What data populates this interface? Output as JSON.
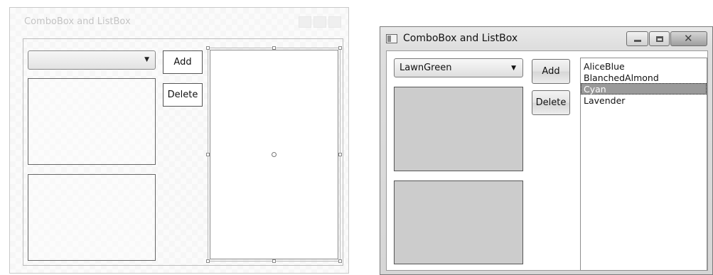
{
  "designer": {
    "title": "ComboBox and ListBox",
    "combo": {
      "value": ""
    },
    "add_label": "Add",
    "delete_label": "Delete"
  },
  "window": {
    "title": "ComboBox and ListBox",
    "combo": {
      "selected": "LawnGreen"
    },
    "add_label": "Add",
    "delete_label": "Delete",
    "listbox": {
      "items": [
        {
          "label": "AliceBlue",
          "selected": false
        },
        {
          "label": "BlanchedAlmond",
          "selected": false
        },
        {
          "label": "Cyan",
          "selected": true
        },
        {
          "label": "Lavender",
          "selected": false
        }
      ]
    }
  },
  "icons": {
    "dropdown_arrow": "▼",
    "close": "✕"
  },
  "colors": {
    "rect_fill": "#cccccc",
    "selection": "#9a9a9a"
  }
}
